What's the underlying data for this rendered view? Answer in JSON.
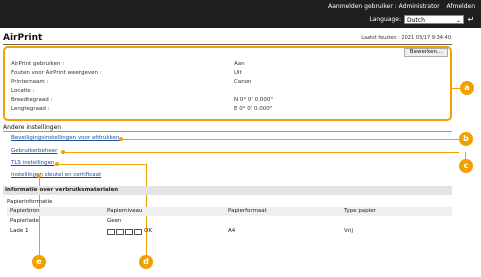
{
  "header": {
    "logged_in_label": "Aanmelden gebruiker :",
    "user": "Administrator",
    "logout": "Afmelden",
    "language_label": "Language:",
    "language_value": "Dutch"
  },
  "page": {
    "title": "AirPrint",
    "last_updated": "Laatst feuzien : 2021 03/17 9:34:40",
    "edit_label": "Bewerken..."
  },
  "settings": [
    {
      "key": "AirPrint gebruiken :",
      "value": "Aan"
    },
    {
      "key": "Fouten voor AirPrint weergeven :",
      "value": "Uit"
    },
    {
      "key": "Printernaam :",
      "value": "Canon"
    },
    {
      "key": "Locatie :",
      "value": ""
    },
    {
      "key": "Breedtegraad :",
      "value": "N 0° 0' 0.000\""
    },
    {
      "key": "Lengtegraad :",
      "value": "E 0° 0' 0.000\""
    }
  ],
  "other_settings": {
    "title": "Andere instellingen",
    "links": [
      "Beveiligingsinstellingen voor afdrukken",
      "Gebruikerbeheer",
      "TLS instellingen",
      "Instellingen sleutel en certificaat"
    ]
  },
  "consumables": {
    "title": "Informatie over verbruiksmaterialen",
    "paper_title": "Papierinformatie",
    "columns": [
      "Papierbron",
      "Papierniveau",
      "Papierformaat",
      "Type papier"
    ],
    "rows": [
      {
        "source": "Papierlade",
        "level": "Geen",
        "size": "",
        "type": ""
      },
      {
        "source": "Lade 1",
        "level": "OK",
        "size": "A4",
        "type": "Vrij"
      }
    ]
  },
  "callouts": [
    "a",
    "b",
    "c",
    "d",
    "e"
  ],
  "colors": {
    "accent": "#f0a000",
    "header_bg": "#1f1f1f",
    "link": "#1a4fa0"
  }
}
